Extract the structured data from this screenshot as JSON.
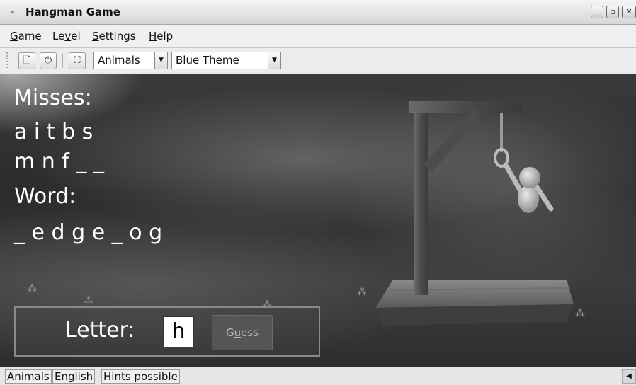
{
  "window": {
    "title": "Hangman Game",
    "controls": {
      "minimize": "_",
      "restore": "▫",
      "close": "✕"
    }
  },
  "menu": {
    "items": [
      {
        "label_pre": "",
        "mnemonic": "G",
        "label_post": "ame"
      },
      {
        "label_pre": "Le",
        "mnemonic": "v",
        "label_post": "el"
      },
      {
        "label_pre": "",
        "mnemonic": "S",
        "label_post": "ettings"
      },
      {
        "label_pre": "",
        "mnemonic": "H",
        "label_post": "elp"
      }
    ]
  },
  "toolbar": {
    "buttons": [
      {
        "icon": "new-game-icon",
        "glyph": "🗋"
      },
      {
        "icon": "quit-icon",
        "glyph": "⏻"
      },
      {
        "icon": "fullscreen-icon",
        "glyph": "⛶"
      }
    ],
    "category": "Animals",
    "theme": "Blue Theme",
    "dropdown_arrow": "▼"
  },
  "game": {
    "misses_label": "Misses:",
    "misses_line1": "a i t b s",
    "misses_line2": "m n f _ _",
    "word_label": "Word:",
    "word": "_ e d g e _ o g",
    "letter_label": "Letter:",
    "letter_value": "h",
    "guess_label_pre": "G",
    "guess_mnemonic": "u",
    "guess_label_post": "ess",
    "misses_count": 8
  },
  "status": {
    "category": "Animals",
    "language": "English",
    "hints": "Hints possible",
    "scroll_glyph": "◀"
  }
}
